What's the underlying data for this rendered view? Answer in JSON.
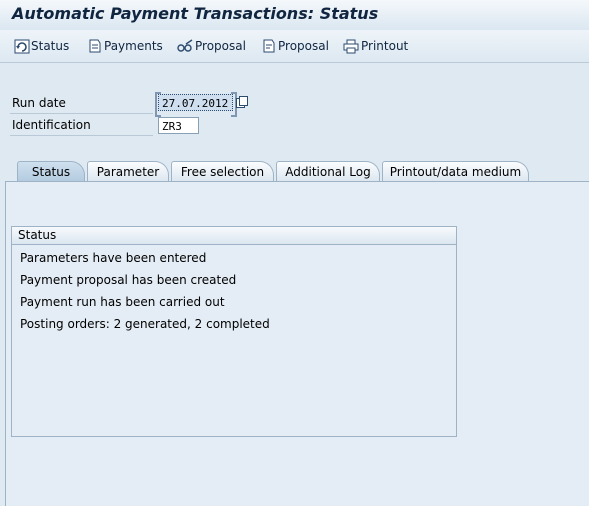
{
  "window": {
    "title": "Automatic Payment Transactions: Status"
  },
  "toolbar": {
    "status_label": "Status",
    "payments_label": "Payments",
    "proposal_edit_label": "Proposal",
    "proposal_label": "Proposal",
    "printout_label": "Printout"
  },
  "form": {
    "run_date_label": "Run date",
    "run_date_value": "27.07.2012",
    "identification_label": "Identification",
    "identification_value": "ZR3"
  },
  "tabs": [
    {
      "label": "Status",
      "active": true
    },
    {
      "label": "Parameter"
    },
    {
      "label": "Free selection"
    },
    {
      "label": "Additional Log"
    },
    {
      "label": "Printout/data medium"
    }
  ],
  "status_group": {
    "title": "Status",
    "lines": [
      "Parameters have been entered",
      "Payment proposal has been created",
      "Payment run has been carried out",
      "Posting orders: 2 generated, 2 completed"
    ]
  },
  "colors": {
    "background": "#dfe9f2",
    "title": "#10253f",
    "border": "#9fb3c6"
  }
}
